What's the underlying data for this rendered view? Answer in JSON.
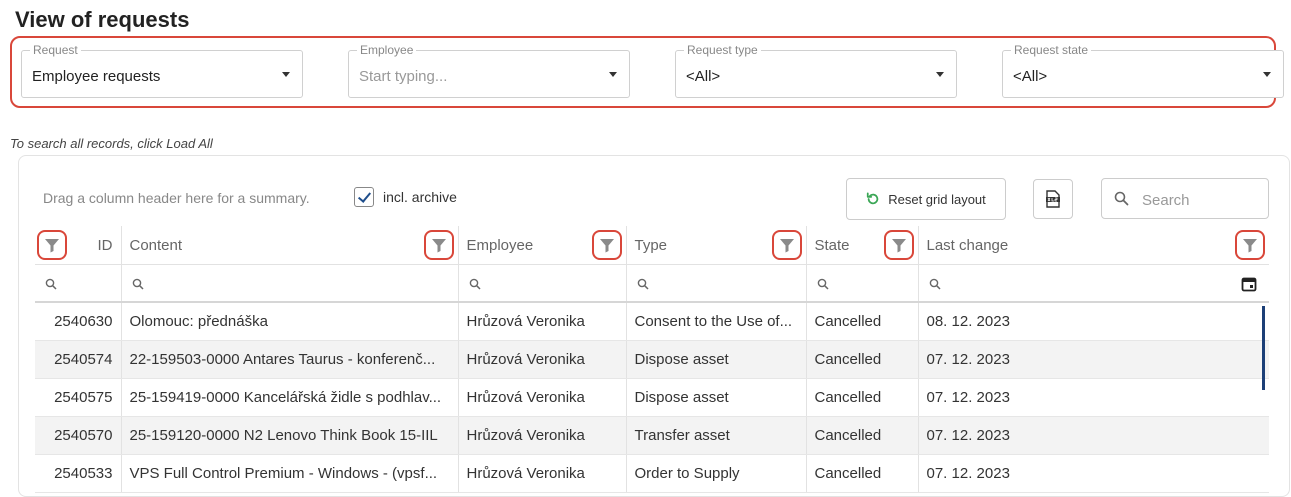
{
  "page": {
    "title": "View of requests"
  },
  "filters": [
    {
      "label": "Request",
      "value": "Employee requests",
      "placeholder": false
    },
    {
      "label": "Employee",
      "value": "Start typing...",
      "placeholder": true
    },
    {
      "label": "Request type",
      "value": "<All>",
      "placeholder": false
    },
    {
      "label": "Request state",
      "value": "<All>",
      "placeholder": false
    }
  ],
  "hint": "To search all records, click Load All",
  "toolbar": {
    "group_hint": "Drag a column header here for a summary.",
    "archive_label": "incl. archive",
    "archive_checked": true,
    "reset_label": "Reset grid layout",
    "xlsx_icon": "xlsx-export-icon",
    "search_placeholder": "Search"
  },
  "columns": [
    "ID",
    "Content",
    "Employee",
    "Type",
    "State",
    "Last change"
  ],
  "rows": [
    [
      "2540630",
      "Olomouc: přednáška",
      "Hrůzová Veronika",
      "Consent to the Use of...",
      "Cancelled",
      "08. 12. 2023"
    ],
    [
      "2540574",
      "22-159503-0000 Antares Taurus - konferenč...",
      "Hrůzová Veronika",
      "Dispose asset",
      "Cancelled",
      "07. 12. 2023"
    ],
    [
      "2540575",
      "25-159419-0000 Kancelářská židle s podhlav...",
      "Hrůzová Veronika",
      "Dispose asset",
      "Cancelled",
      "07. 12. 2023"
    ],
    [
      "2540570",
      "25-159120-0000 N2 Lenovo Think Book 15-IIL",
      "Hrůzová Veronika",
      "Transfer asset",
      "Cancelled",
      "07. 12. 2023"
    ],
    [
      "2540533",
      "VPS Full Control Premium - Windows - (vpsf...",
      "Hrůzová Veronika",
      "Order to Supply",
      "Cancelled",
      "07. 12. 2023"
    ]
  ],
  "colors": {
    "highlight": "#d9473a",
    "accent": "#1c3f77",
    "reset_icon": "#3aa655"
  }
}
